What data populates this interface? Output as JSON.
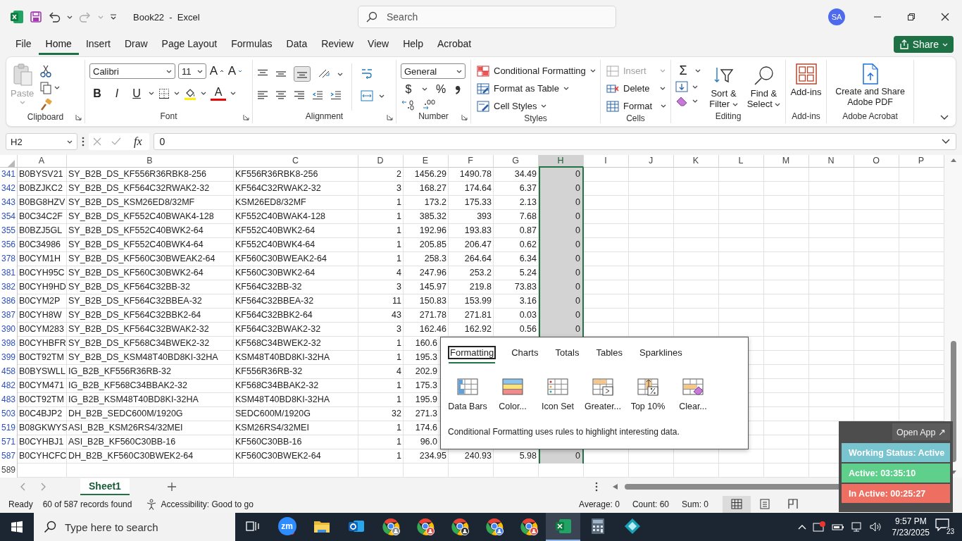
{
  "title_bar": {
    "title": "Book22  -  Excel",
    "search_placeholder": "Search",
    "user_initials": "SA"
  },
  "menu_tabs": [
    {
      "label": "File",
      "selected": false
    },
    {
      "label": "Home",
      "selected": true
    },
    {
      "label": "Insert",
      "selected": false
    },
    {
      "label": "Draw",
      "selected": false
    },
    {
      "label": "Page Layout",
      "selected": false
    },
    {
      "label": "Formulas",
      "selected": false
    },
    {
      "label": "Data",
      "selected": false
    },
    {
      "label": "Review",
      "selected": false
    },
    {
      "label": "View",
      "selected": false
    },
    {
      "label": "Help",
      "selected": false
    },
    {
      "label": "Acrobat",
      "selected": false
    }
  ],
  "share_button": "Share",
  "ribbon": {
    "groups": [
      {
        "kind": "clipboard",
        "label": "Clipboard",
        "paste": {
          "label": "Paste",
          "disabled": true
        }
      },
      {
        "kind": "font",
        "label": "Font",
        "font_name": "Calibri",
        "font_size": "11",
        "size_buttons": [
          "A",
          "A"
        ],
        "style_buttons": [
          {
            "kind": "bold",
            "text": "B"
          },
          {
            "kind": "italic",
            "text": "I"
          },
          {
            "kind": "underline",
            "text": "U"
          }
        ],
        "font_color": "A"
      },
      {
        "kind": "alignment",
        "label": "Alignment"
      },
      {
        "kind": "number",
        "label": "Number",
        "format": "General",
        "symbols": [
          "$",
          "%"
        ]
      },
      {
        "kind": "styles",
        "label": "Styles",
        "items": [
          "Conditional Formatting",
          "Format as Table",
          "Cell Styles"
        ]
      },
      {
        "kind": "cells",
        "label": "Cells",
        "items": [
          {
            "label": "Insert",
            "disabled": true
          },
          {
            "label": "Delete",
            "disabled": false
          },
          {
            "label": "Format",
            "disabled": false
          }
        ]
      },
      {
        "kind": "editing",
        "label": "Editing",
        "autosum": "Σ",
        "buttons": [
          "Sort & Filter",
          "Find & Select"
        ]
      },
      {
        "kind": "addins",
        "label": "Add-ins",
        "button": "Add-ins"
      },
      {
        "kind": "acrobat",
        "label": "Adobe Acrobat",
        "button": "Create and Share Adobe PDF"
      }
    ]
  },
  "formula_bar": {
    "name_box": "H2",
    "fx": "fx",
    "formula": "0"
  },
  "sheet": {
    "columns": [
      {
        "label": "A",
        "selected": false
      },
      {
        "label": "B",
        "selected": false
      },
      {
        "label": "C",
        "selected": false
      },
      {
        "label": "D",
        "selected": false
      },
      {
        "label": "E",
        "selected": false
      },
      {
        "label": "F",
        "selected": false
      },
      {
        "label": "G",
        "selected": false
      },
      {
        "label": "H",
        "selected": true
      },
      {
        "label": "I",
        "selected": false
      },
      {
        "label": "J",
        "selected": false
      },
      {
        "label": "K",
        "selected": false
      },
      {
        "label": "L",
        "selected": false
      },
      {
        "label": "M",
        "selected": false
      },
      {
        "label": "N",
        "selected": false
      },
      {
        "label": "O",
        "selected": false
      },
      {
        "label": "P",
        "selected": false
      }
    ],
    "rows": [
      {
        "number": "341",
        "filtered": true,
        "cells": [
          "B0BYSV21",
          "SY_B2B_DS_KF556R36RBK8-256",
          "KF556R36RBK8-256",
          "2",
          "1456.29",
          "1490.78",
          "34.49",
          "0"
        ]
      },
      {
        "number": "342",
        "filtered": true,
        "cells": [
          "B0BZJKC2",
          "SY_B2B_DS_KF564C32RWAK2-32",
          "KF564C32RWAK2-32",
          "3",
          "168.27",
          "174.64",
          "6.37",
          "0"
        ]
      },
      {
        "number": "343",
        "filtered": true,
        "cells": [
          "B0BG8HZV",
          "SY_B2B_DS_KSM26ED8/32MF",
          "KSM26ED8/32MF",
          "1",
          "173.2",
          "175.33",
          "2.13",
          "0"
        ]
      },
      {
        "number": "354",
        "filtered": true,
        "cells": [
          "B0C34C2F",
          "SY_B2B_DS_KF552C40BWAK4-128",
          "KF552C40BWAK4-128",
          "1",
          "385.32",
          "393",
          "7.68",
          "0"
        ]
      },
      {
        "number": "355",
        "filtered": true,
        "cells": [
          "B0BZJ5GL",
          "SY_B2B_DS_KF552C40BWK2-64",
          "KF552C40BWK2-64",
          "1",
          "192.96",
          "193.83",
          "0.87",
          "0"
        ]
      },
      {
        "number": "356",
        "filtered": true,
        "cells": [
          "B0C34986",
          "SY_B2B_DS_KF552C40BWK4-64",
          "KF552C40BWK4-64",
          "1",
          "205.85",
          "206.47",
          "0.62",
          "0"
        ]
      },
      {
        "number": "378",
        "filtered": true,
        "cells": [
          "B0CYM1H",
          "SY_B2B_DS_KF560C30BWEAK2-64",
          "KF560C30BWEAK2-64",
          "1",
          "258.3",
          "264.64",
          "6.34",
          "0"
        ]
      },
      {
        "number": "381",
        "filtered": true,
        "cells": [
          "B0CYH95C",
          "SY_B2B_DS_KF560C30BWK2-64",
          "KF560C30BWK2-64",
          "4",
          "247.96",
          "253.2",
          "5.24",
          "0"
        ]
      },
      {
        "number": "382",
        "filtered": true,
        "cells": [
          "B0CYH9HD",
          "SY_B2B_DS_KF564C32BB-32",
          "KF564C32BB-32",
          "3",
          "145.97",
          "219.8",
          "73.83",
          "0"
        ]
      },
      {
        "number": "386",
        "filtered": true,
        "cells": [
          "B0CYM2P",
          "SY_B2B_DS_KF564C32BBEA-32",
          "KF564C32BBEA-32",
          "11",
          "150.83",
          "153.99",
          "3.16",
          "0"
        ]
      },
      {
        "number": "387",
        "filtered": true,
        "cells": [
          "B0CYH8W",
          "SY_B2B_DS_KF564C32BBK2-64",
          "KF564C32BBK2-64",
          "43",
          "271.78",
          "271.81",
          "0.03",
          "0"
        ]
      },
      {
        "number": "390",
        "filtered": true,
        "cells": [
          "B0CYM283",
          "SY_B2B_DS_KF564C32BWAK2-32",
          "KF564C32BWAK2-32",
          "3",
          "162.46",
          "162.92",
          "0.56",
          "0"
        ]
      },
      {
        "number": "398",
        "filtered": true,
        "cells": [
          "B0CYHBFR",
          "SY_B2B_DS_KF568C34BWEK2-32",
          "KF568C34BWEK2-32",
          "1",
          "160.6"
        ]
      },
      {
        "number": "399",
        "filtered": true,
        "cells": [
          "B0CT92TM",
          "SY_B2B_DS_KSM48T40BD8KI-32HA",
          "KSM48T40BD8KI-32HA",
          "1",
          "195.3"
        ]
      },
      {
        "number": "458",
        "filtered": true,
        "cells": [
          "B0BYSWLL",
          "IG_B2B_KF556R36RB-32",
          "KF556R36RB-32",
          "4",
          "202.9"
        ]
      },
      {
        "number": "482",
        "filtered": true,
        "cells": [
          "B0CYM471",
          "IG_B2B_KF568C34BBAK2-32",
          "KF568C34BBAK2-32",
          "1",
          "175.3"
        ]
      },
      {
        "number": "483",
        "filtered": true,
        "cells": [
          "B0CT92TM",
          "IG_B2B_KSM48T40BD8KI-32HA",
          "KSM48T40BD8KI-32HA",
          "1",
          "195.9"
        ]
      },
      {
        "number": "503",
        "filtered": true,
        "cells": [
          "B0C4BJP2",
          "DH_B2B_SEDC600M/1920G",
          "SEDC600M/1920G",
          "32",
          "271.3"
        ]
      },
      {
        "number": "519",
        "filtered": true,
        "cells": [
          "B08GKWYS",
          "ASI_B2B_KSM26RS4/32MEI",
          "KSM26RS4/32MEI",
          "1",
          "174.6"
        ]
      },
      {
        "number": "571",
        "filtered": true,
        "cells": [
          "B0CYHBJ1",
          "ASI_B2B_KF560C30BB-16",
          "KF560C30BB-16",
          "1",
          "96.0"
        ]
      },
      {
        "number": "587",
        "filtered": true,
        "cells": [
          "B0CYHCFC",
          "DH_B2B_KF560C30BWEK2-64",
          "KF560C30BWEK2-64",
          "1",
          "234.95",
          "240.93",
          "5.98",
          "0"
        ]
      },
      {
        "number": "589",
        "filtered": false
      }
    ]
  },
  "quick_analysis": {
    "tabs": [
      {
        "label": "Formatting",
        "selected": true
      },
      {
        "label": "Charts",
        "selected": false
      },
      {
        "label": "Totals",
        "selected": false
      },
      {
        "label": "Tables",
        "selected": false
      },
      {
        "label": "Sparklines",
        "selected": false
      }
    ],
    "actions": [
      {
        "kind": "data_bars",
        "label": "Data Bars"
      },
      {
        "kind": "color_scale",
        "label": "Color..."
      },
      {
        "kind": "icon_set",
        "label": "Icon Set"
      },
      {
        "kind": "greater",
        "label": "Greater..."
      },
      {
        "kind": "top",
        "label": "Top 10%"
      },
      {
        "kind": "clear",
        "label": "Clear..."
      }
    ],
    "description": "Conditional Formatting uses rules to highlight interesting data."
  },
  "sheet_tabs": [
    {
      "label": "Sheet1",
      "selected": true
    }
  ],
  "status_bar": {
    "mode": "Ready",
    "filter_info": "60 of 587 records found",
    "accessibility": "Accessibility: Good to go",
    "average": "Average: 0",
    "count": "Count: 60",
    "sum": "Sum: 0",
    "views": [
      {
        "kind": "normal",
        "selected": true
      },
      {
        "kind": "page_layout",
        "selected": false
      },
      {
        "kind": "page_break",
        "selected": false
      }
    ]
  },
  "tracker": {
    "open_app": "Open App ↗",
    "rows": [
      {
        "text": "Working Status: Active",
        "color": "#78c4cf"
      },
      {
        "text": "Active: 03:35:10",
        "color": "#5fd08b"
      },
      {
        "text": "In Active: 00:25:27",
        "color": "#ee6f62"
      }
    ]
  },
  "taskbar": {
    "search_placeholder": "Type here to search",
    "apps": [
      {
        "kind": "task_view",
        "selected": false
      },
      {
        "kind": "zoom",
        "text": "zm",
        "selected": false
      },
      {
        "kind": "folder",
        "selected": false
      },
      {
        "kind": "mail",
        "selected": false
      },
      {
        "kind": "browser",
        "color": "#8a8a8a",
        "selected": false
      },
      {
        "kind": "browser",
        "color": "#e0443a",
        "selected": false
      },
      {
        "kind": "browser",
        "color": "#2b2b2b",
        "selected": false
      },
      {
        "kind": "browser",
        "color": "#3b78e7",
        "selected": false
      },
      {
        "kind": "browser",
        "color": "#e0443a",
        "selected": false
      },
      {
        "kind": "sheet",
        "selected": true
      },
      {
        "kind": "calculator",
        "selected": false
      },
      {
        "kind": "diamond",
        "selected": false
      }
    ],
    "time": "9:57 PM",
    "date": "7/23/2025",
    "notifications": "23"
  }
}
